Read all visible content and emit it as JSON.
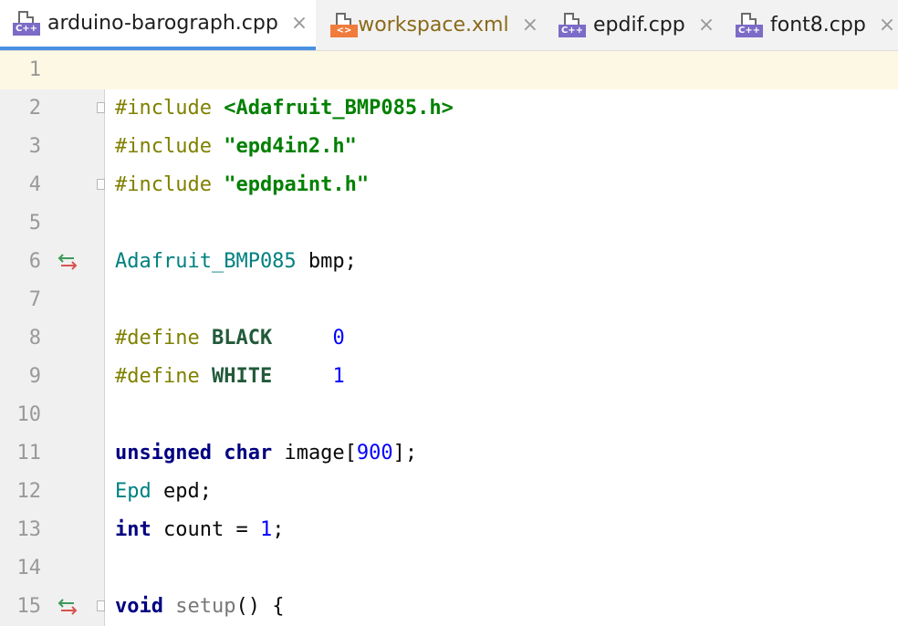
{
  "tabs": [
    {
      "label": "arduino-barograph.cpp",
      "badge": "C++",
      "active": true
    },
    {
      "label": "workspace.xml",
      "badge": "<>",
      "active": false
    },
    {
      "label": "epdif.cpp",
      "badge": "C++",
      "active": false
    },
    {
      "label": "font8.cpp",
      "badge": "C++",
      "active": false
    }
  ],
  "close_glyph": "×",
  "gutter": {
    "line_numbers": [
      "1",
      "2",
      "3",
      "4",
      "5",
      "6",
      "7",
      "8",
      "9",
      "10",
      "11",
      "12",
      "13",
      "14",
      "15"
    ]
  },
  "code": {
    "l2": {
      "directive": "#include",
      "header": "<Adafruit_BMP085.h>"
    },
    "l3": {
      "directive": "#include",
      "header": "\"epd4in2.h\""
    },
    "l4": {
      "directive": "#include",
      "header": "\"epdpaint.h\""
    },
    "l6": {
      "type": "Adafruit_BMP085",
      "rest": " bmp;"
    },
    "l8": {
      "directive": "#define",
      "name": "BLACK",
      "value": "0"
    },
    "l9": {
      "directive": "#define",
      "name": "WHITE",
      "value": "1"
    },
    "l11": {
      "kw1": "unsigned",
      "kw2": "char",
      "ident": " image[",
      "num": "900",
      "tail": "];"
    },
    "l12": {
      "type": "Epd",
      "rest": " epd;"
    },
    "l13": {
      "kw": "int",
      "ident": " count = ",
      "num": "1",
      "tail": ";"
    },
    "l15": {
      "kw": "void",
      "fn": "setup",
      "tail": "() {"
    }
  },
  "colors": {
    "active_tab_underline": "#4a90e2",
    "current_line": "#fdf8e4"
  }
}
